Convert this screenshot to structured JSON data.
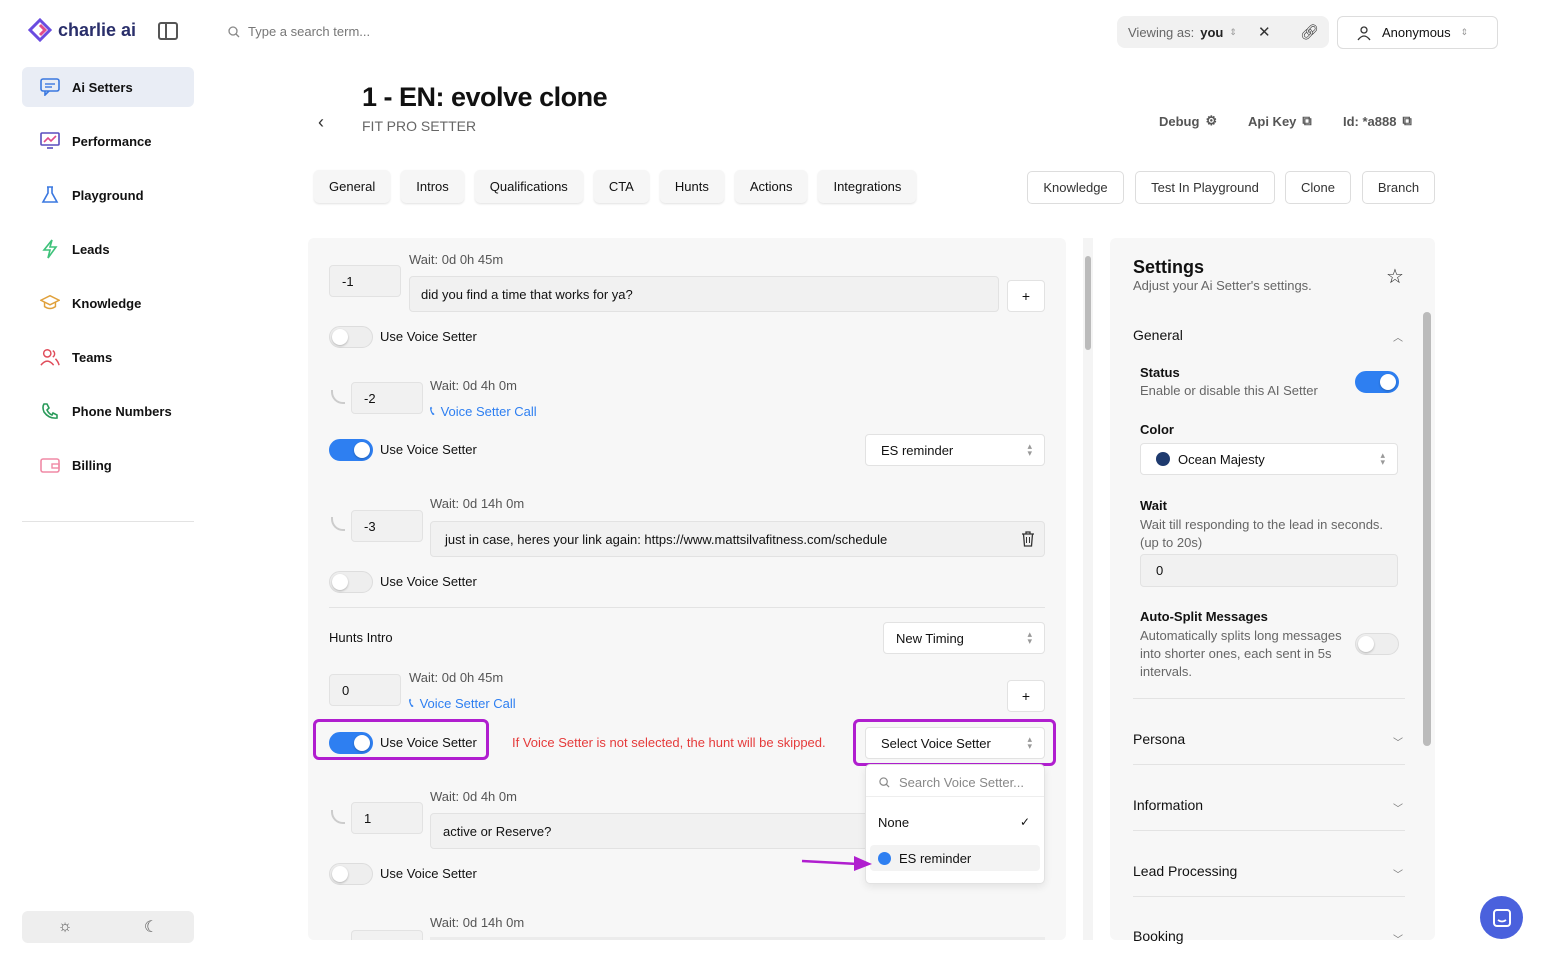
{
  "brand": {
    "name": "charlie ai"
  },
  "sidebar": {
    "items": [
      {
        "label": "Ai Setters",
        "icon": "chat-icon"
      },
      {
        "label": "Performance",
        "icon": "chart-icon"
      },
      {
        "label": "Playground",
        "icon": "flask-icon"
      },
      {
        "label": "Leads",
        "icon": "bolt-icon"
      },
      {
        "label": "Knowledge",
        "icon": "cap-icon"
      },
      {
        "label": "Teams",
        "icon": "users-icon"
      },
      {
        "label": "Phone Numbers",
        "icon": "phone-icon"
      },
      {
        "label": "Billing",
        "icon": "wallet-icon"
      }
    ]
  },
  "search": {
    "placeholder": "Type a search term..."
  },
  "viewing": {
    "prefix": "Viewing as:",
    "value": "you"
  },
  "user": {
    "name": "Anonymous"
  },
  "page": {
    "title": "1 - EN: evolve clone",
    "subtitle": "FIT PRO SETTER",
    "debug": "Debug",
    "api_key": "Api Key",
    "id": "Id: *a888"
  },
  "tabs": [
    "General",
    "Intros",
    "Qualifications",
    "CTA",
    "Hunts",
    "Actions",
    "Integrations"
  ],
  "actions": {
    "knowledge": "Knowledge",
    "test": "Test In Playground",
    "clone": "Clone",
    "branch": "Branch"
  },
  "main": {
    "use_voice_label": "Use Voice Setter",
    "voice_call": "Voice Setter Call",
    "steps": [
      {
        "num": "-1",
        "wait": "Wait: 0d 0h 45m",
        "message": "did you find a time that works for ya?"
      },
      {
        "num": "-2",
        "wait": "Wait: 0d 4h 0m",
        "voice_select": "ES reminder"
      },
      {
        "num": "-3",
        "wait": "Wait: 0d 14h 0m",
        "message": "just in case, heres your link again: https://www.mattsilvafitness.com/schedule"
      }
    ],
    "hunts_intro": {
      "label": "Hunts Intro",
      "timing": "New Timing"
    },
    "hunt_steps": [
      {
        "num": "0",
        "wait": "Wait: 0d 0h 45m"
      },
      {
        "num": "1",
        "wait": "Wait: 0d 4h 0m",
        "message": "active or Reserve?"
      },
      {
        "wait": "Wait: 0d 14h 0m"
      }
    ],
    "warning": "If Voice Setter is not selected, the hunt will be skipped.",
    "select_voice": "Select Voice Setter",
    "dropdown": {
      "search_placeholder": "Search Voice Setter...",
      "options": [
        "None",
        "ES reminder"
      ],
      "selected": "None"
    },
    "plus": "+"
  },
  "settings": {
    "title": "Settings",
    "subtitle": "Adjust your Ai Setter's settings.",
    "general": "General",
    "status": {
      "label": "Status",
      "desc": "Enable or disable this AI Setter"
    },
    "color": {
      "label": "Color",
      "value": "Ocean Majesty",
      "swatch": "#1e3a6e"
    },
    "wait": {
      "label": "Wait",
      "desc": "Wait till responding to the lead in seconds. (up to 20s)",
      "value": "0"
    },
    "autosplit": {
      "label": "Auto-Split Messages",
      "desc": "Automatically splits long messages into shorter ones, each sent in 5s intervals."
    },
    "sections": [
      "Persona",
      "Information",
      "Lead Processing",
      "Booking"
    ]
  },
  "colors": {
    "accent": "#2e7ff1",
    "highlight": "#b01ecf",
    "warning": "#e53b3b"
  }
}
